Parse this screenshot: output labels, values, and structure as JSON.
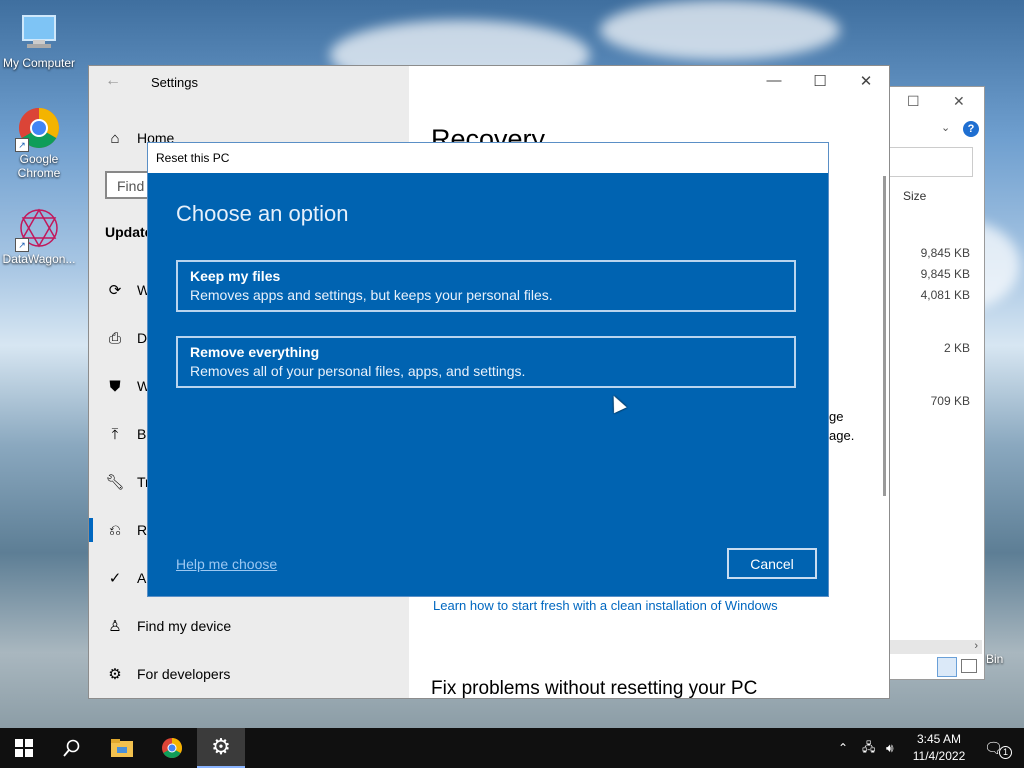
{
  "desktop": {
    "icons": [
      {
        "label": "My Computer",
        "icon": "computer-icon"
      },
      {
        "label": "Google Chrome",
        "icon": "chrome-icon"
      },
      {
        "label": "DataWagon...",
        "icon": "datawagon-icon"
      },
      {
        "label": "Bin",
        "icon": "recycle-bin-icon"
      }
    ]
  },
  "explorer": {
    "column_header": "Size",
    "sizes": [
      "9,845 KB",
      "9,845 KB",
      "4,081 KB",
      "2 KB",
      "709 KB"
    ]
  },
  "settings": {
    "window_title": "Settings",
    "search_placeholder": "Find",
    "nav": [
      {
        "label": "Home",
        "icon": "home-icon"
      },
      {
        "label": "Update",
        "icon": ""
      },
      {
        "label": "W",
        "icon": "sync-icon"
      },
      {
        "label": "De",
        "icon": "delivery-icon"
      },
      {
        "label": "W",
        "icon": "shield-icon"
      },
      {
        "label": "Ba",
        "icon": "backup-icon"
      },
      {
        "label": "Tr",
        "icon": "wrench-icon"
      },
      {
        "label": "Re",
        "icon": "recovery-icon"
      },
      {
        "label": "Ac",
        "icon": "activation-icon"
      },
      {
        "label": "Find my device",
        "icon": "person-pin-icon"
      },
      {
        "label": "For developers",
        "icon": "developer-icon"
      }
    ],
    "page_title": "Recovery",
    "partial_text_1": "ge",
    "partial_text_2": "age.",
    "link_text": "Learn how to start fresh with a clean installation of Windows",
    "section_heading": "Fix problems without resetting your PC"
  },
  "dialog": {
    "title": "Reset this PC",
    "heading": "Choose an option",
    "options": [
      {
        "title": "Keep my files",
        "description": "Removes apps and settings, but keeps your personal files."
      },
      {
        "title": "Remove everything",
        "description": "Removes all of your personal files, apps, and settings."
      }
    ],
    "help_link": "Help me choose",
    "cancel_label": "Cancel"
  },
  "taskbar": {
    "time": "3:45 AM",
    "date": "11/4/2022",
    "notification_count": "1"
  },
  "colors": {
    "dialog_bg": "#0063b1",
    "accent": "#0067c0"
  }
}
